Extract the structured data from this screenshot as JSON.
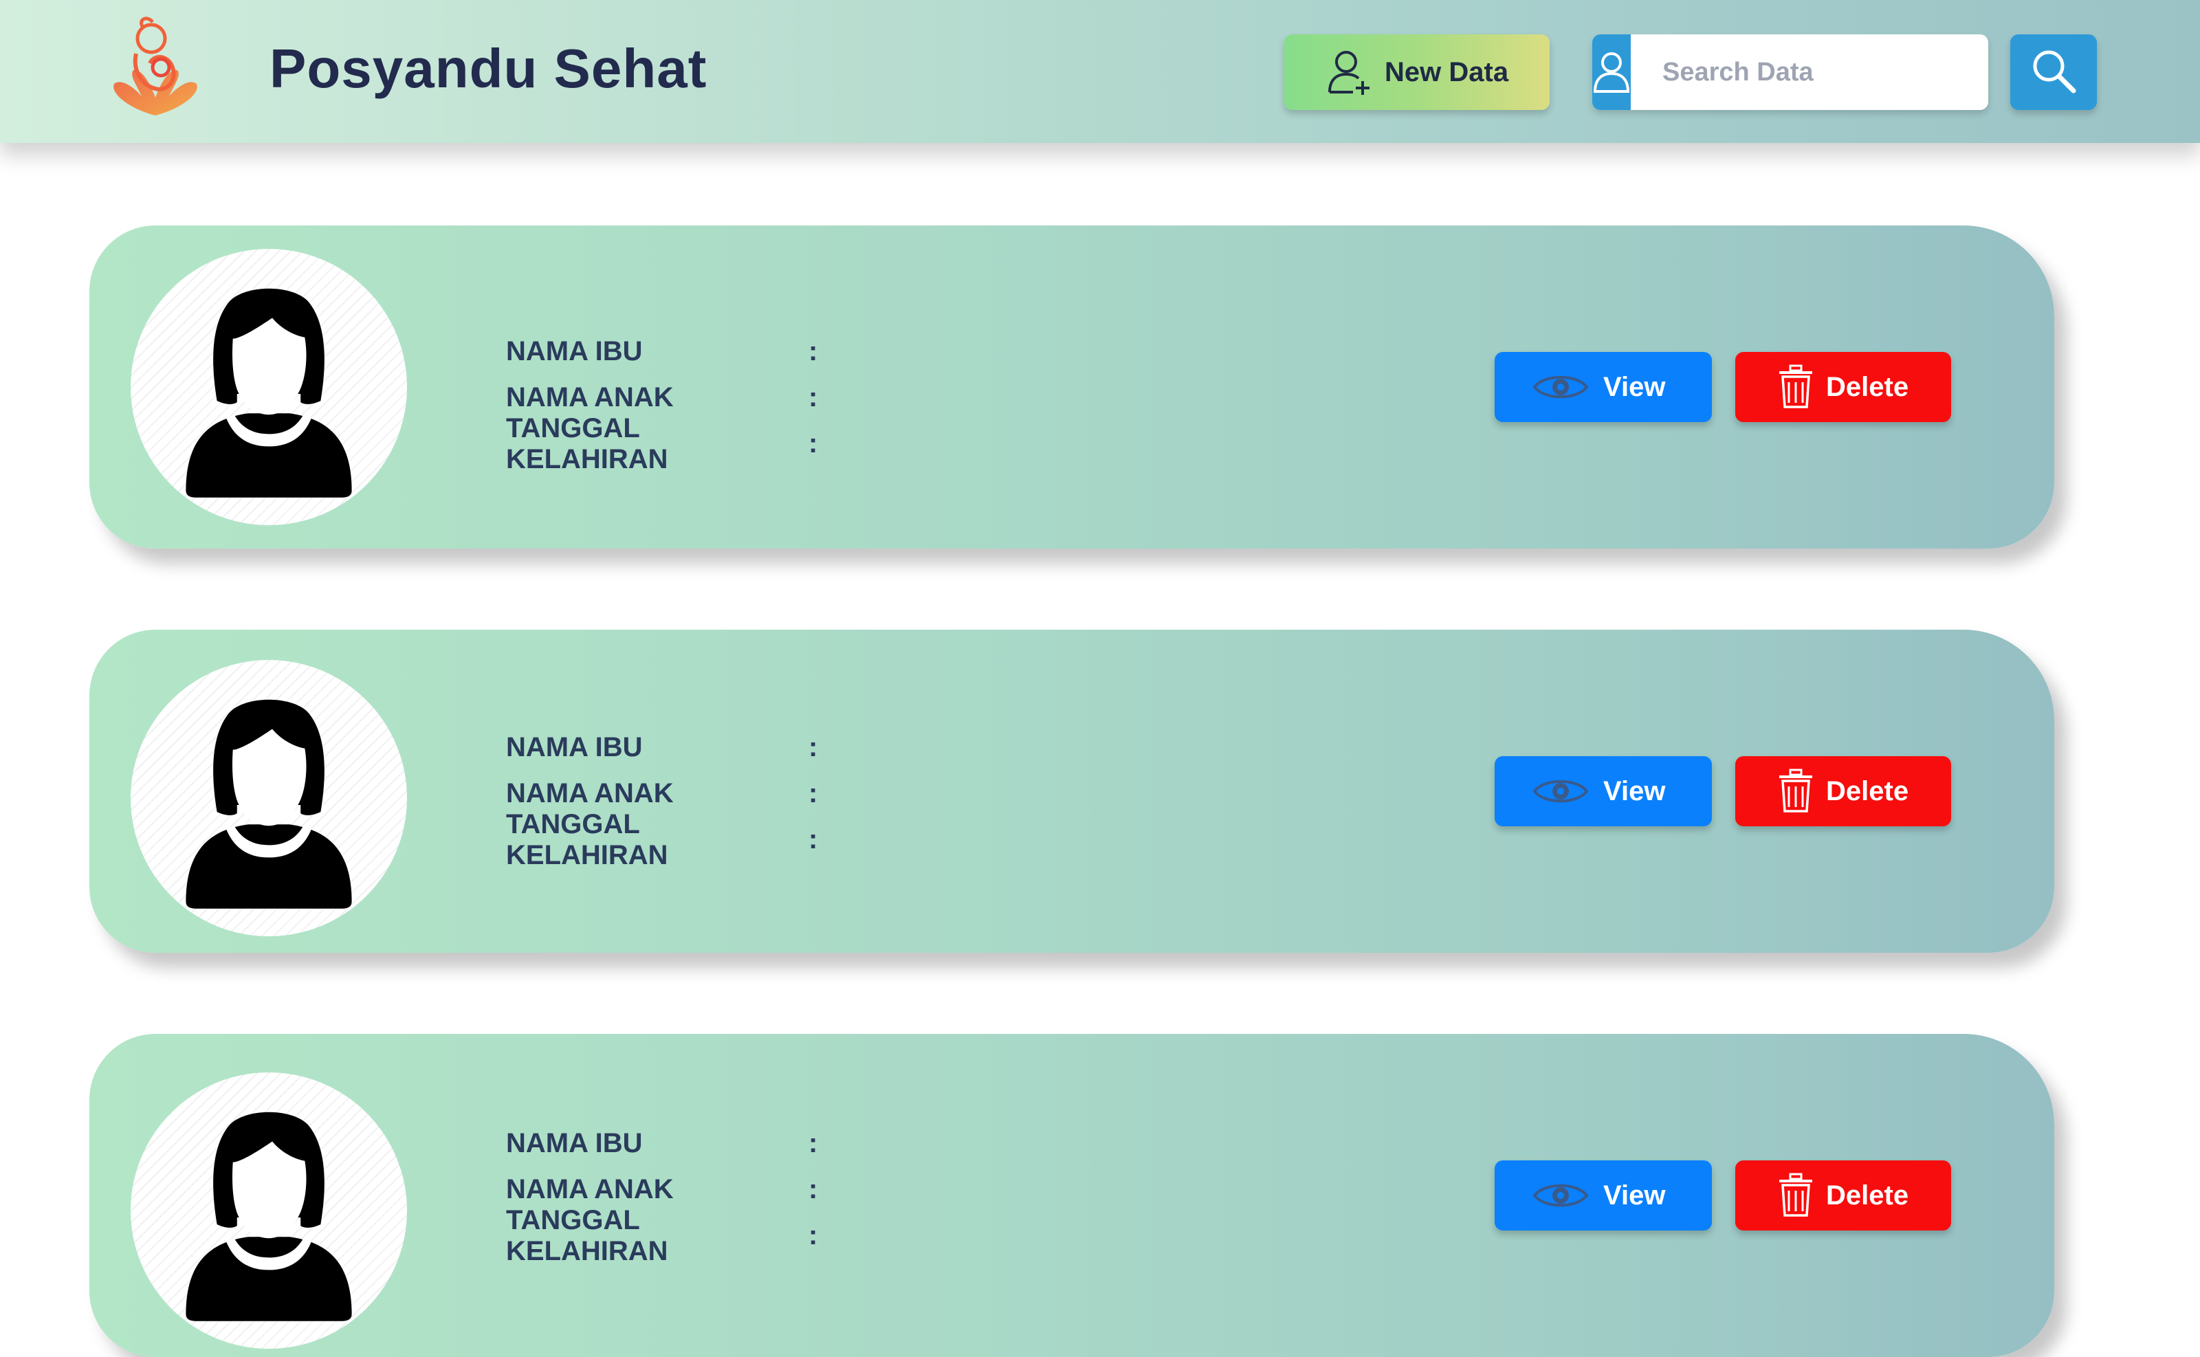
{
  "header": {
    "logo_icon": "mother-child-logo-icon",
    "title": "Posyandu Sehat",
    "new_data_label": "New Data",
    "new_data_icon": "add-user-icon",
    "search_placeholder": "Search Data",
    "user_icon": "user-icon",
    "search_icon": "search-icon"
  },
  "colors": {
    "title_text": "#222b4e",
    "new_data_gradient": [
      "#87dd8a",
      "#dadd82"
    ],
    "search_blue": "#2d9ad7",
    "view_button": "#0a80fd",
    "delete_button": "#f70d0d",
    "card_gradient": [
      "#b3e6c7",
      "#95bfc4"
    ]
  },
  "cards": [
    {
      "avatar_icon": "female-avatar-icon",
      "fields": [
        {
          "label": "NAMA IBU",
          "sep": ":",
          "value": ""
        },
        {
          "label": "NAMA ANAK",
          "sep": ":",
          "value": ""
        },
        {
          "label": "TANGGAL KELAHIRAN",
          "sep": ":",
          "value": ""
        }
      ],
      "view_label": "View",
      "view_icon": "eye-icon",
      "delete_label": "Delete",
      "delete_icon": "trash-icon"
    },
    {
      "avatar_icon": "female-avatar-icon",
      "fields": [
        {
          "label": "NAMA IBU",
          "sep": ":",
          "value": ""
        },
        {
          "label": "NAMA ANAK",
          "sep": ":",
          "value": ""
        },
        {
          "label": "TANGGAL KELAHIRAN",
          "sep": ":",
          "value": ""
        }
      ],
      "view_label": "View",
      "view_icon": "eye-icon",
      "delete_label": "Delete",
      "delete_icon": "trash-icon"
    },
    {
      "avatar_icon": "female-avatar-icon",
      "fields": [
        {
          "label": "NAMA IBU",
          "sep": ":",
          "value": ""
        },
        {
          "label": "NAMA ANAK",
          "sep": ":",
          "value": ""
        },
        {
          "label": "TANGGAL KELAHIRAN",
          "sep": ":",
          "value": ""
        }
      ],
      "view_label": "View",
      "view_icon": "eye-icon",
      "delete_label": "Delete",
      "delete_icon": "trash-icon"
    }
  ]
}
